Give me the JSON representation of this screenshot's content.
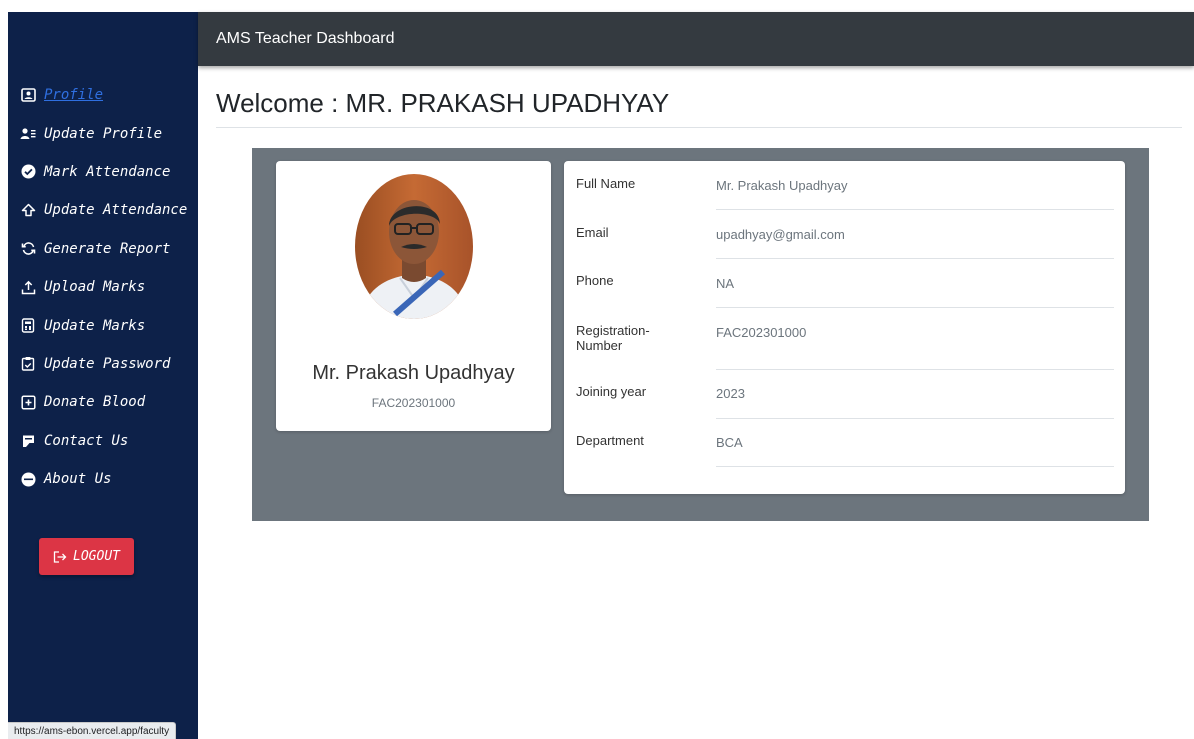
{
  "app": {
    "title": "AMS Teacher Dashboard"
  },
  "sidebar": {
    "items": [
      {
        "label": "Profile",
        "icon": "id-card-icon",
        "active": true
      },
      {
        "label": "Update Profile",
        "icon": "user-list-icon"
      },
      {
        "label": "Mark Attendance",
        "icon": "check-circle-icon"
      },
      {
        "label": "Update Attendance",
        "icon": "upload-arrow-icon"
      },
      {
        "label": "Generate Report",
        "icon": "refresh-icon"
      },
      {
        "label": "Upload Marks",
        "icon": "upload-icon"
      },
      {
        "label": "Update Marks",
        "icon": "calculator-icon"
      },
      {
        "label": "Update Password",
        "icon": "clipboard-icon"
      },
      {
        "label": "Donate Blood",
        "icon": "plus-square-icon"
      },
      {
        "label": "Contact Us",
        "icon": "contact-icon"
      },
      {
        "label": "About Us",
        "icon": "smile-icon"
      }
    ],
    "logout_label": "LOGOUT"
  },
  "status_bar": {
    "url": "https://ams-ebon.vercel.app/faculty"
  },
  "main": {
    "welcome": "Welcome : MR. PRAKASH UPADHYAY",
    "profile_card": {
      "name": "Mr. Prakash Upadhyay",
      "registration": "FAC202301000"
    },
    "details": [
      {
        "label": "Full Name",
        "value": "Mr. Prakash Upadhyay"
      },
      {
        "label": "Email",
        "value": "upadhyay@gmail.com"
      },
      {
        "label": "Phone",
        "value": "NA"
      },
      {
        "label": "Registration-Number",
        "value": "FAC202301000"
      },
      {
        "label": "Joining year",
        "value": "2023"
      },
      {
        "label": "Department",
        "value": "BCA"
      }
    ]
  },
  "colors": {
    "sidebar": "#0d2149",
    "topbar": "#343a40",
    "panel": "#6c757d",
    "logout": "#dc3545",
    "active_link": "#2f6fe0"
  }
}
